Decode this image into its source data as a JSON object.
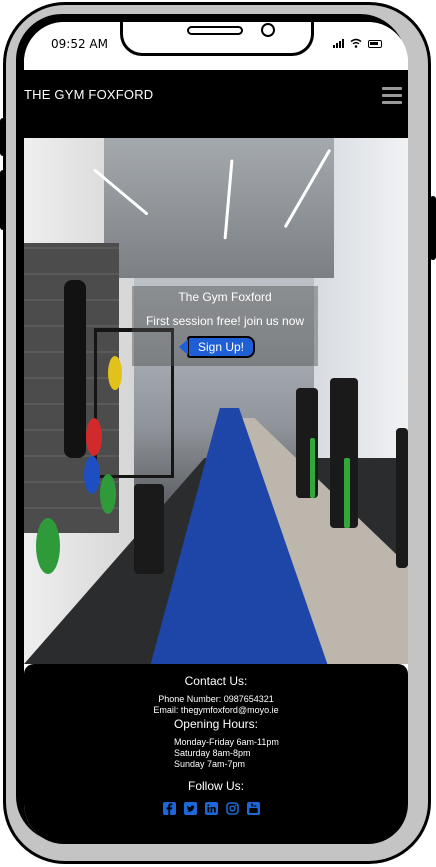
{
  "status_bar": {
    "time": "09:52 AM"
  },
  "navbar": {
    "brand": "THE GYM FOXFORD",
    "menu_icon": "hamburger-menu-icon"
  },
  "hero": {
    "title": "The Gym Foxford",
    "text": "First session free! join us now",
    "cta_label": "Sign Up!"
  },
  "footer": {
    "contact_heading": "Contact Us:",
    "phone": "Phone Number: 0987654321",
    "email": "Email: thegymfoxford@moyo.ie",
    "hours_heading": "Opening Hours:",
    "hours": [
      "Monday-Friday 6am-11pm",
      "Saturday 8am-8pm",
      "Sunday 7am-7pm"
    ],
    "follow_heading": "Follow Us:",
    "social_icons": [
      "facebook-icon",
      "twitter-icon",
      "linkedin-icon",
      "instagram-icon",
      "youtube-icon"
    ]
  },
  "colors": {
    "accent": "#1d68d8",
    "navbar": "#000000",
    "cta": "#1f5fd6"
  }
}
